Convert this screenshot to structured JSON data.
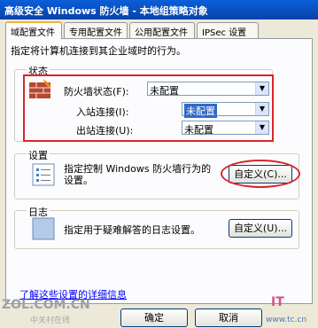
{
  "window": {
    "title": "高级安全 Windows 防火墙 - 本地组策略对象"
  },
  "tabs": [
    {
      "label": "域配置文件"
    },
    {
      "label": "专用配置文件"
    },
    {
      "label": "公用配置文件"
    },
    {
      "label": "IPSec 设置"
    }
  ],
  "main": {
    "description": "指定将计算机连接到其企业域时的行为。",
    "state": {
      "label": "状态",
      "firewall_state_label": "防火墙状态(F):",
      "firewall_state_value": "未配置",
      "inbound_label": "入站连接(I):",
      "inbound_value": "未配置",
      "outbound_label": "出站连接(U):",
      "outbound_value": "未配置"
    },
    "settings": {
      "label": "设置",
      "description_line1": "指定控制 Windows 防火墙行为的",
      "description_line2": "设置。",
      "customize_button": "自定义(C)..."
    },
    "logging": {
      "label": "日志",
      "description": "指定用于疑难解答的日志设置。",
      "customize_button": "自定义(U)..."
    },
    "more_link": "了解这些设置的详细信息"
  },
  "footer": {
    "ok_button": "确定",
    "cancel_button": "取消"
  },
  "watermarks": {
    "left_main": "ZOL.COM.CN",
    "left_sub": "中关村在线",
    "right_main": "IT",
    "right_sub": "www.tc.cn"
  }
}
